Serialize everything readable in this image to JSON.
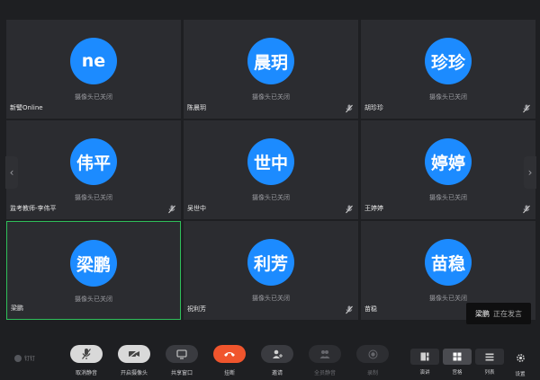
{
  "tiles": [
    {
      "avatar": "ne",
      "name": "新譬Online",
      "status": "摄像头已关闭"
    },
    {
      "avatar": "晨玥",
      "name": "陈晨玥",
      "status": "摄像头已关闭"
    },
    {
      "avatar": "珍珍",
      "name": "胡珍珍",
      "status": "摄像头已关闭"
    },
    {
      "avatar": "伟平",
      "name": "监考教师-李伟平",
      "status": "摄像头已关闭"
    },
    {
      "avatar": "世中",
      "name": "吴世中",
      "status": "摄像头已关闭"
    },
    {
      "avatar": "婷婷",
      "name": "王婷婷",
      "status": "摄像头已关闭"
    },
    {
      "avatar": "梁鹏",
      "name": "梁鹏",
      "status": "摄像头已关闭"
    },
    {
      "avatar": "利芳",
      "name": "祝利芳",
      "status": "摄像头已关闭"
    },
    {
      "avatar": "苗稳",
      "name": "苗稳",
      "status": "摄像头已关闭"
    }
  ],
  "speaking": {
    "who": "梁鹏",
    "state": "正在发言"
  },
  "logo_text": "钉钉",
  "toolbar": {
    "unmute": "取消静音",
    "camera": "开启摄像头",
    "share": "共享窗口",
    "hangup": "挂断",
    "invite": "邀请",
    "mute_all": "全员静音",
    "record": "录制",
    "speaker_view": "演讲",
    "grid_view": "宫格",
    "list_view": "列表",
    "settings": "设置"
  },
  "colors": {
    "avatar": "#1c8bff",
    "active_border": "#2fbf5a",
    "hangup": "#f0552d"
  }
}
